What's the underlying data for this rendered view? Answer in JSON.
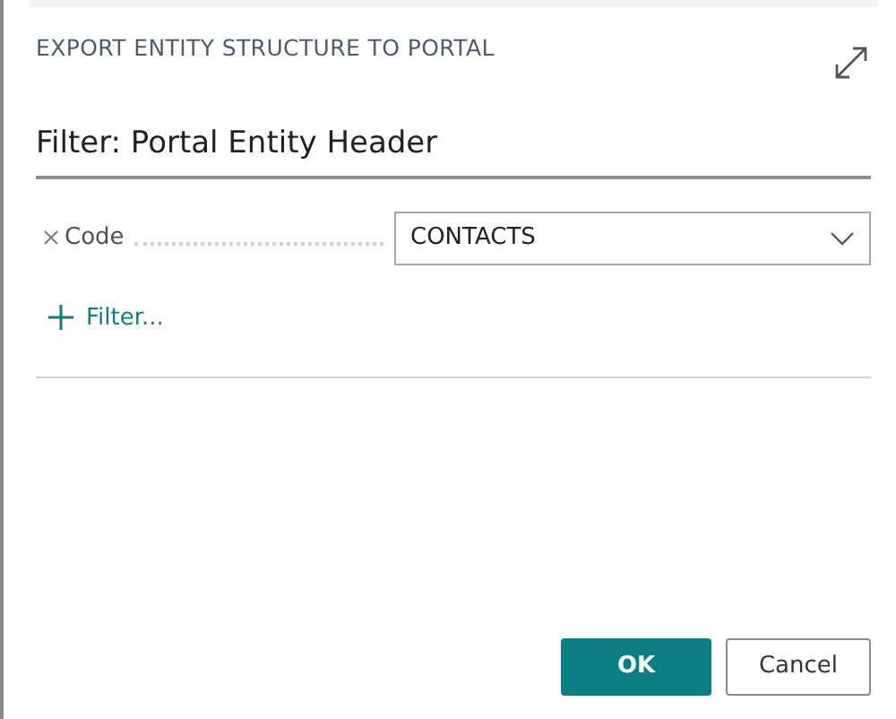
{
  "dialog": {
    "title": "EXPORT ENTITY STRUCTURE TO PORTAL",
    "heading": "Filter: Portal Entity Header",
    "filters": [
      {
        "field": "Code",
        "value": "CONTACTS"
      }
    ],
    "add_filter": "Filter...",
    "buttons": [
      {
        "label": "OK",
        "kind": "primary"
      },
      {
        "label": "Cancel",
        "kind": "secondary"
      }
    ]
  }
}
